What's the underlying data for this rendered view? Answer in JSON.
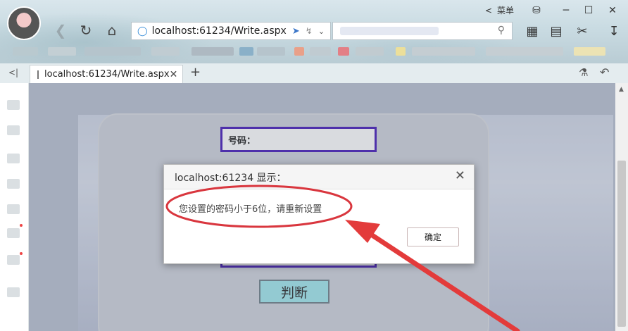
{
  "browser": {
    "menu_label": "菜单",
    "address_url": "localhost:61234/Write.aspx",
    "tab_title": "localhost:61234/Write.aspx",
    "tab_close": "✕",
    "new_tab": "+",
    "sidebar_toggle": "<|",
    "window_controls": {
      "back": "<",
      "minimize": "─",
      "maximize": "☐",
      "close": "✕"
    }
  },
  "page": {
    "phone_label": "号码：",
    "judge_button": "判断"
  },
  "dialog": {
    "title": "localhost:61234 显示：",
    "message": "您设置的密码小于6位，请重新设置",
    "ok_button": "确定",
    "close_icon": "✕"
  },
  "colors": {
    "field_border": "#3f12b8",
    "button_bg": "#9fe8ee",
    "annotation_red": "#d9363e"
  },
  "icons": [
    "back-arrow-icon",
    "refresh-icon",
    "home-icon",
    "shield-icon",
    "rocket-icon",
    "lightning-icon",
    "chevron-down-icon",
    "search-icon",
    "grid-icon",
    "book-icon",
    "scissors-icon",
    "download-icon",
    "shirt-icon",
    "undo-icon",
    "bag-icon"
  ]
}
